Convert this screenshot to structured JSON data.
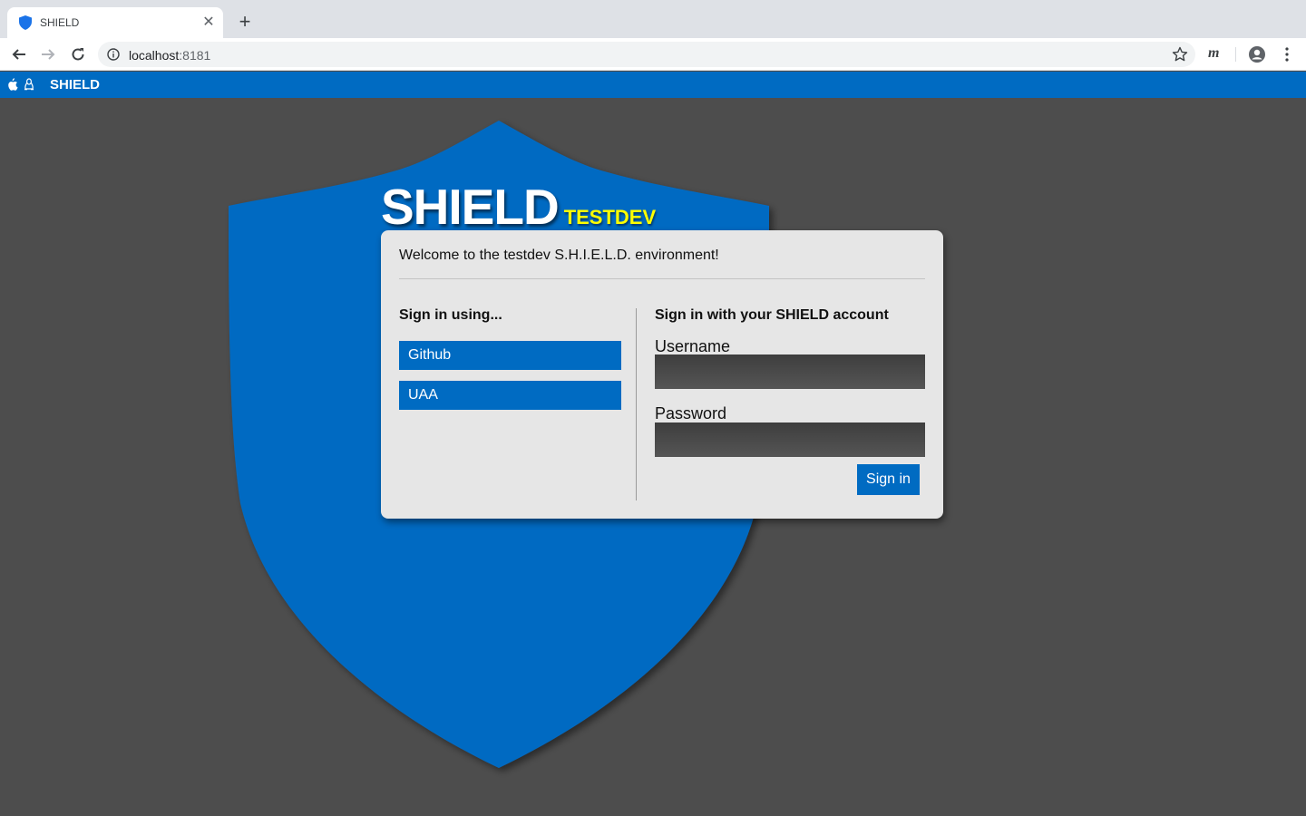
{
  "browser": {
    "tab_title": "SHIELD",
    "url_host": "localhost",
    "url_port": ":8181",
    "extension_label": "m"
  },
  "appbar": {
    "title": "SHIELD",
    "icons": [
      "apple-icon",
      "linux-icon"
    ]
  },
  "brand": {
    "name": "SHIELD",
    "environment": "TESTDEV"
  },
  "login": {
    "welcome": "Welcome to the testdev S.H.I.E.L.D. environment!",
    "sso_heading": "Sign in using...",
    "providers": [
      {
        "label": "Github"
      },
      {
        "label": "UAA"
      }
    ],
    "local_heading": "Sign in with your SHIELD account",
    "username_label": "Username",
    "username_value": "",
    "password_label": "Password",
    "password_value": "",
    "submit_label": "Sign in"
  },
  "colors": {
    "brand_blue": "#006bc2",
    "background": "#4d4d4d",
    "env_yellow": "#ffff00",
    "card": "#e6e6e6"
  }
}
